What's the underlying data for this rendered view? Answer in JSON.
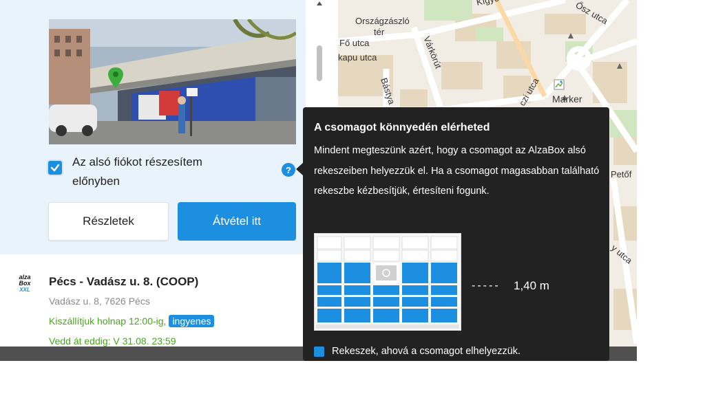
{
  "selected": {
    "preference_label": "Az alsó fiókot részesítem előnyben",
    "help_icon": "?",
    "details_label": "Részletek",
    "pickup_label": "Átvétel itt"
  },
  "location": {
    "logo_line1": "alza",
    "logo_line2": "Box",
    "logo_line3": "XXL",
    "title": "Pécs - Vadász u. 8. (COOP)",
    "address": "Vadász u. 8, 7626 Pécs",
    "delivery": "Kiszállítjuk holnap 12:00-ig,",
    "free_badge": "ingyenes",
    "pickup_until": "Vedd át eddig: V 31.08. 23:59"
  },
  "map": {
    "streets": {
      "orszagzaszlo": "Országzászló",
      "ter": "tér",
      "fo_utca": "Fő utca",
      "kapu_utca": "kapu utca",
      "varkorut": "Várkörút",
      "basya": "Bástya",
      "kigyo": "Kígyó",
      "osz_utca": "Ősz utca",
      "petofi": "Petőf",
      "y_utca": "y utca",
      "czi_utca": "czi utca"
    },
    "marker_label": "Marker"
  },
  "tooltip": {
    "title": "A csomagot könnyedén elérheted",
    "body": "Mindent megteszünk azért, hogy a csomagot az AlzaBox alsó rekeszeiben helyezzük el. Ha a csomagot magasabban található rekeszbe kézbesítjük, értesíteni fogunk.",
    "height_dashes": "-----",
    "height_value": "1,40 m",
    "legend": "Rekeszek, ahová a csomagot elhelyezzük."
  },
  "colors": {
    "accent": "#1d8fe1",
    "green": "#48a51e",
    "tooltip_bg": "#222222",
    "selected_bg": "#e9f3fc"
  }
}
